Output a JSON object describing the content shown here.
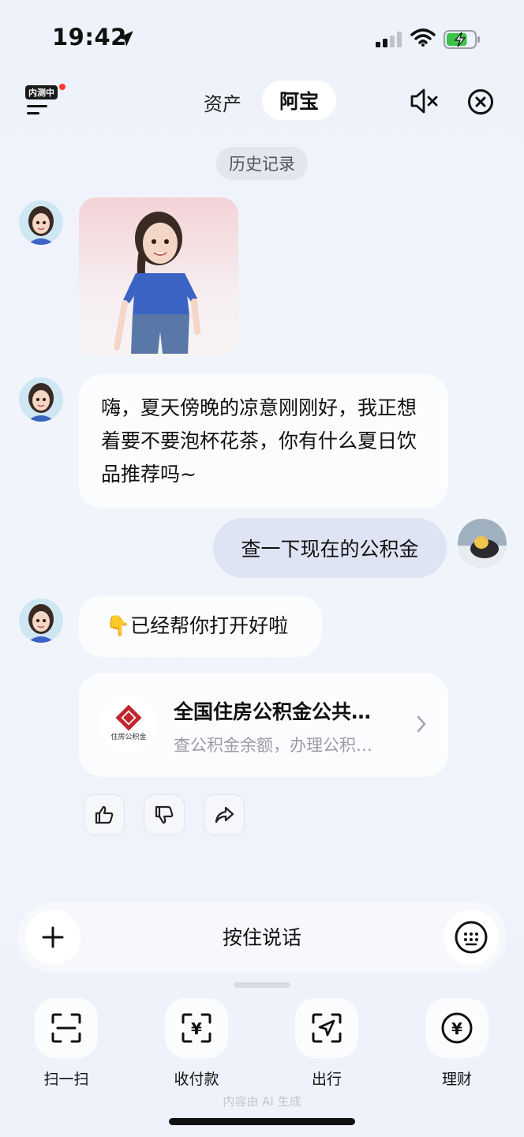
{
  "status_bar": {
    "time": "19:42",
    "battery_level": 0.75
  },
  "header": {
    "beta_tag": "内测中",
    "tabs": [
      {
        "label": "资产"
      },
      {
        "label": "阿宝",
        "active": true
      }
    ]
  },
  "history_label": "历史记录",
  "messages": {
    "bot_greeting": "嗨，夏天傍晚的凉意刚刚好，我正想着要不要泡杯花茶，你有什么夏日饮品推荐吗~",
    "user_query": "查一下现在的公积金",
    "bot_reply": "👇已经帮你打开好啦"
  },
  "service_card": {
    "title": "全国住房公积金公共…",
    "subtitle": "查公积金余额，办理公积…",
    "logo_text": "住房公积金",
    "logo_color": "#c0262d"
  },
  "input_bar": {
    "hold_to_talk": "按住说话"
  },
  "quick_actions": [
    {
      "label": "扫一扫",
      "icon": "scan-icon"
    },
    {
      "label": "收付款",
      "icon": "yuan-payment-icon"
    },
    {
      "label": "出行",
      "icon": "navigation-icon"
    },
    {
      "label": "理财",
      "icon": "yuan-circle-icon"
    }
  ],
  "footer_note": "内容由 AI 生成",
  "colors": {
    "accent_user_bubble": "#dfe4f5",
    "background": "#eef2fb"
  }
}
